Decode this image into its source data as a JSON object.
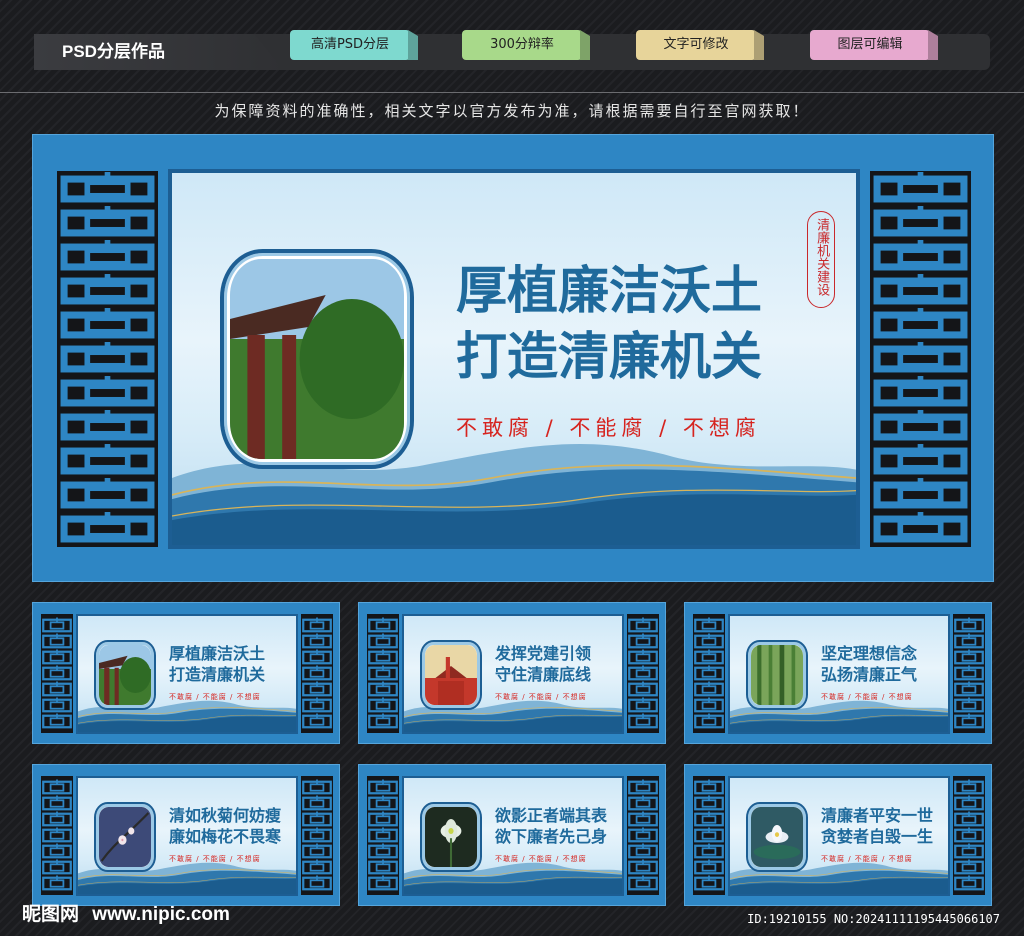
{
  "topbar": {
    "brand": "PSD分层作品",
    "tags": [
      {
        "label": "高清PSD分层",
        "color": "#7ed9cf"
      },
      {
        "label": "300分辩率",
        "color": "#a8d98a"
      },
      {
        "label": "文字可修改",
        "color": "#e7d49a"
      },
      {
        "label": "图层可编辑",
        "color": "#e7a9cf"
      }
    ]
  },
  "notice": "为保障资料的准确性，相关文字以官方发布为准，请根据需要自行至官网获取！",
  "main_board": {
    "line1": "厚植廉洁沃土",
    "line2": "打造清廉机关",
    "slogan": "不敢腐 / 不能腐 / 不想腐",
    "seal_text": "清廉机关建设"
  },
  "thumbnails": [
    {
      "line1": "厚植廉洁沃土",
      "line2": "打造清廉机关",
      "slogan": "不敢腐 / 不能腐 / 不想腐",
      "photo": "pavilion"
    },
    {
      "line1": "发挥党建引领",
      "line2": "守住清廉底线",
      "slogan": "不敢腐 / 不能腐 / 不想腐",
      "photo": "tiananmen"
    },
    {
      "line1": "坚定理想信念",
      "line2": "弘扬清廉正气",
      "slogan": "不敢腐 / 不能腐 / 不想腐",
      "photo": "bamboo"
    },
    {
      "line1": "清如秋菊何妨瘦",
      "line2": "廉如梅花不畏寒",
      "slogan": "不敢腐 / 不能腐 / 不想腐",
      "photo": "plum"
    },
    {
      "line1": "欲影正者端其表",
      "line2": "欲下廉者先己身",
      "slogan": "不敢腐 / 不能腐 / 不想腐",
      "photo": "flower"
    },
    {
      "line1": "清廉者平安一世",
      "line2": "贪婪者自毁一生",
      "slogan": "不敢腐 / 不能腐 / 不想腐",
      "photo": "lotus"
    }
  ],
  "footer": {
    "logo": "昵图网",
    "url": "www.nipic.com",
    "id": "ID:19210155 NO:20241111195445066107"
  }
}
